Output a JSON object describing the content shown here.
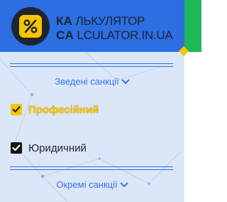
{
  "header": {
    "logo_icon": "percent-icon",
    "brand_line1_bold": "КА",
    "brand_line1_rest": "ЛЬКУЛЯТОР",
    "brand_line2_bold": "CA",
    "brand_line2_rest": "LCULATOR.IN.UA"
  },
  "panel": {
    "section1_label": "Зведені санкції",
    "section2_label": "Окремі санкції",
    "options": [
      {
        "label": "Професійний",
        "checked": true,
        "active": true
      },
      {
        "label": "Юридичний",
        "checked": true,
        "active": false
      }
    ]
  },
  "colors": {
    "header_blue": "#2b6fe3",
    "accent_yellow": "#f7c600",
    "panel_bg": "#dbe6f8",
    "green": "#20b957",
    "dark": "#1f2430"
  }
}
